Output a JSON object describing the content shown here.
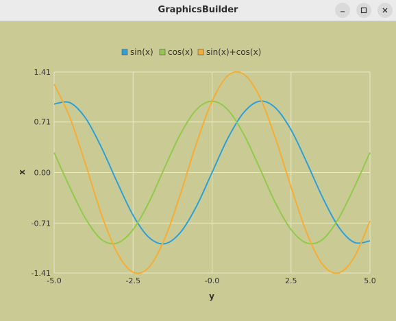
{
  "window": {
    "title": "GraphicsBuilder",
    "buttons": [
      {
        "label": "",
        "icon": "minimize-icon"
      },
      {
        "label": "",
        "icon": "maximize-icon"
      },
      {
        "label": "",
        "icon": "close-icon"
      }
    ]
  },
  "colors": {
    "background": "#c9ca94",
    "grid": "#e8e8c8",
    "sin": "#2f9fd8",
    "cos": "#93c94c",
    "sum": "#f6ad35"
  },
  "chart_data": {
    "type": "line",
    "title": "",
    "xlabel": "y",
    "ylabel": "x",
    "xlim": [
      -5.0,
      5.0
    ],
    "ylim": [
      -1.41,
      1.41
    ],
    "x_ticks": [
      -5.0,
      -2.5,
      0.0,
      2.5,
      5.0
    ],
    "x_tick_labels": [
      "-5.0",
      "-2.5",
      "-0.0",
      "2.5",
      "5.0"
    ],
    "y_ticks": [
      1.41,
      0.71,
      0.0,
      -0.71,
      -1.41
    ],
    "y_tick_labels": [
      "1.41",
      "0.71",
      "0.00",
      "-0.71",
      "-1.41"
    ],
    "grid": true,
    "legend_position": "top-center",
    "x": [
      -5.0,
      -4.5,
      -4.0,
      -3.5,
      -3.0,
      -2.5,
      -2.0,
      -1.5,
      -1.0,
      -0.5,
      0.0,
      0.5,
      1.0,
      1.5,
      2.0,
      2.5,
      3.0,
      3.5,
      4.0,
      4.5,
      5.0
    ],
    "series": [
      {
        "name": "sin(x)",
        "color": "#2f9fd8",
        "values": [
          0.96,
          0.98,
          0.76,
          0.35,
          -0.14,
          -0.6,
          -0.91,
          -1.0,
          -0.84,
          -0.48,
          0.0,
          0.48,
          0.84,
          1.0,
          0.91,
          0.6,
          0.14,
          -0.35,
          -0.76,
          -0.98,
          -0.96
        ]
      },
      {
        "name": "cos(x)",
        "color": "#93c94c",
        "values": [
          0.28,
          -0.21,
          -0.65,
          -0.94,
          -0.99,
          -0.8,
          -0.42,
          0.07,
          0.54,
          0.88,
          1.0,
          0.88,
          0.54,
          0.07,
          -0.42,
          -0.8,
          -0.99,
          -0.94,
          -0.65,
          -0.21,
          0.28
        ]
      },
      {
        "name": "sin(x)+cos(x)",
        "color": "#f6ad35",
        "values": [
          1.24,
          0.77,
          0.11,
          -0.59,
          -1.13,
          -1.4,
          -1.33,
          -0.93,
          -0.3,
          0.4,
          1.0,
          1.36,
          1.38,
          1.07,
          0.49,
          -0.2,
          -0.85,
          -1.29,
          -1.41,
          -1.19,
          -0.68
        ]
      }
    ]
  }
}
